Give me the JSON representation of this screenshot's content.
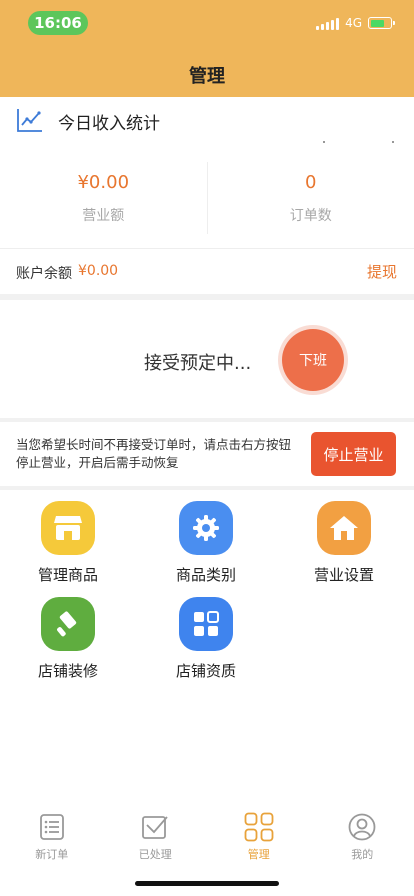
{
  "status_bar": {
    "time": "16:06",
    "network": "4G"
  },
  "header": {
    "title": "管理"
  },
  "stats": {
    "title": "今日收入统计",
    "revenue_value": "¥0.00",
    "revenue_label": "营业额",
    "orders_value": "0",
    "orders_label": "订单数"
  },
  "balance": {
    "label": "账户余额",
    "value": "¥0.00",
    "withdraw": "提现"
  },
  "accepting": {
    "text": "接受预定中...",
    "off_button": "下班"
  },
  "stop": {
    "hint": "当您希望长时间不再接受订单时，请点击右方按钮停止营业，开启后需手动恢复",
    "button": "停止营业"
  },
  "grid": [
    {
      "label": "管理商品",
      "icon": "shop-icon",
      "color": "#f5c93a"
    },
    {
      "label": "商品类别",
      "icon": "gear-icon",
      "color": "#4a8ef0"
    },
    {
      "label": "营业设置",
      "icon": "home-icon",
      "color": "#f2a042"
    },
    {
      "label": "店铺装修",
      "icon": "brush-icon",
      "color": "#5fad3f"
    },
    {
      "label": "店铺资质",
      "icon": "apps-icon",
      "color": "#3f84ee"
    }
  ],
  "tabs": [
    {
      "label": "新订单",
      "icon": "list-icon"
    },
    {
      "label": "已处理",
      "icon": "check-box-icon"
    },
    {
      "label": "管理",
      "icon": "grid-icon",
      "active": true
    },
    {
      "label": "我的",
      "icon": "user-icon"
    }
  ],
  "colors": {
    "header": "#efb65a",
    "accent": "#e8762f",
    "stop_button": "#e9542f",
    "off_button": "#ed6f4a",
    "tab_active": "#e8a23a"
  }
}
